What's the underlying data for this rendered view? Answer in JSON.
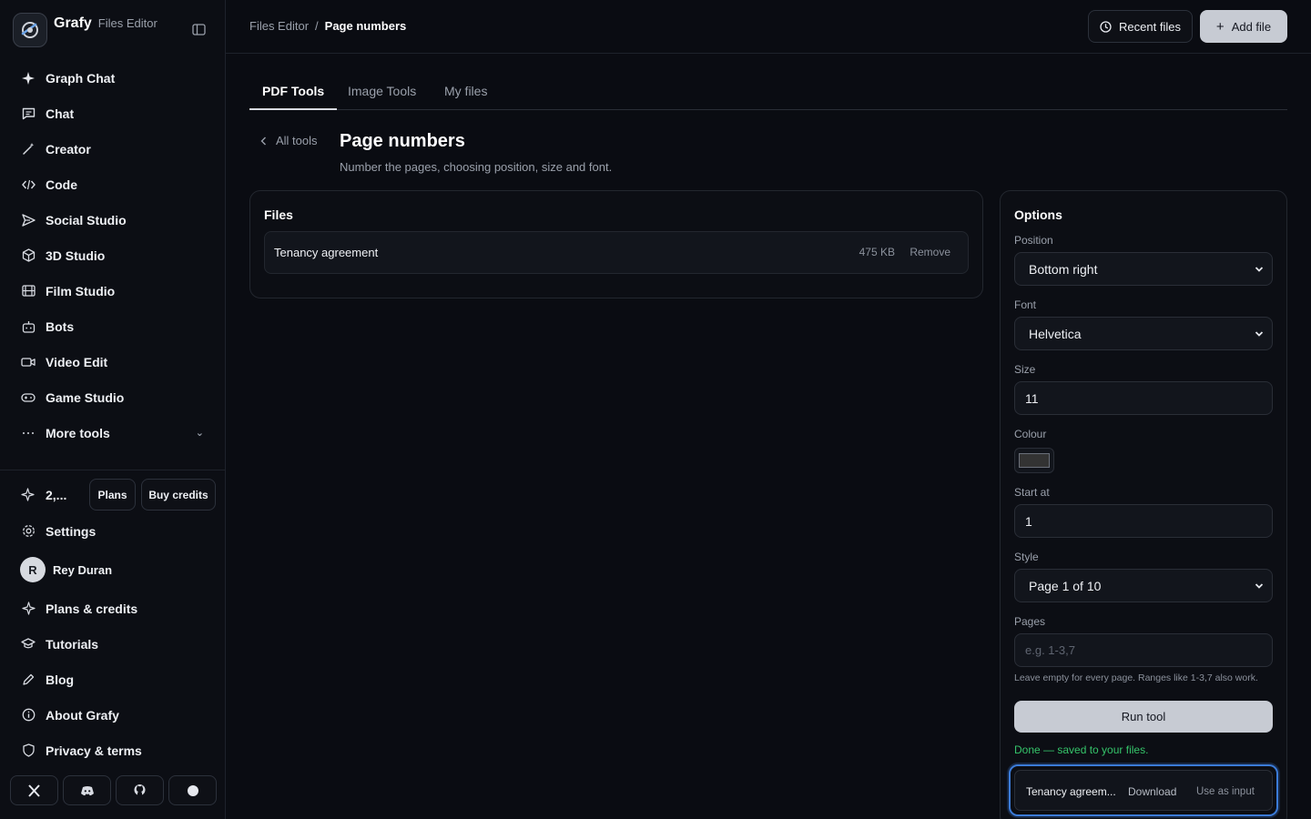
{
  "brand": {
    "name": "Grafy",
    "subtitle": "Files Editor"
  },
  "sidebar": {
    "items": [
      {
        "label": "Graph Chat",
        "icon": "sparkle-icon"
      },
      {
        "label": "Chat",
        "icon": "chat-bubble-icon"
      },
      {
        "label": "Creator",
        "icon": "magic-wand-icon"
      },
      {
        "label": "Code",
        "icon": "code-icon"
      },
      {
        "label": "Social Studio",
        "icon": "send-icon"
      },
      {
        "label": "3D Studio",
        "icon": "cube-icon"
      },
      {
        "label": "Film Studio",
        "icon": "film-icon"
      },
      {
        "label": "Bots",
        "icon": "bot-icon"
      },
      {
        "label": "Video Edit",
        "icon": "video-camera-icon"
      },
      {
        "label": "Game Studio",
        "icon": "gamepad-icon"
      },
      {
        "label": "More tools",
        "icon": "ellipsis-icon"
      }
    ],
    "credits": {
      "value": "2,...",
      "plans_label": "Plans",
      "buy_label": "Buy credits"
    },
    "settings_label": "Settings",
    "user": {
      "initial": "R",
      "name": "Rey Duran"
    },
    "lower_items": [
      {
        "label": "Plans & credits",
        "icon": "sparkle-icon"
      },
      {
        "label": "Tutorials",
        "icon": "graduation-cap-icon"
      },
      {
        "label": "Blog",
        "icon": "pen-icon"
      },
      {
        "label": "About Grafy",
        "icon": "info-icon"
      },
      {
        "label": "Privacy & terms",
        "icon": "shield-icon"
      }
    ],
    "social": [
      "x-icon",
      "discord-icon",
      "github-icon",
      "circle-icon"
    ]
  },
  "topbar": {
    "breadcrumb": {
      "parent": "Files Editor",
      "separator": "/",
      "current": "Page numbers"
    },
    "recent_files_label": "Recent files",
    "add_file_label": "Add file"
  },
  "tabs": [
    {
      "label": "PDF Tools",
      "active": true
    },
    {
      "label": "Image Tools",
      "active": false
    },
    {
      "label": "My files",
      "active": false
    }
  ],
  "tool": {
    "back_label": "All tools",
    "title": "Page numbers",
    "description": "Number the pages, choosing position, size and font."
  },
  "files": {
    "title": "Files",
    "items": [
      {
        "name": "Tenancy agreement",
        "size": "475 KB",
        "remove_label": "Remove"
      }
    ]
  },
  "options": {
    "title": "Options",
    "position": {
      "label": "Position",
      "value": "Bottom right"
    },
    "font": {
      "label": "Font",
      "value": "Helvetica"
    },
    "size": {
      "label": "Size",
      "value": "11"
    },
    "colour": {
      "label": "Colour",
      "value": "#333333"
    },
    "start_at": {
      "label": "Start at",
      "value": "1"
    },
    "style": {
      "label": "Style",
      "value": "Page 1 of 10"
    },
    "pages": {
      "label": "Pages",
      "value": "",
      "placeholder": "e.g. 1-3,7"
    },
    "hint": "Leave empty for every page. Ranges like 1-3,7 also work.",
    "run_label": "Run tool",
    "status": "Done — saved to your files."
  },
  "result": {
    "name": "Tenancy agreem...",
    "download_label": "Download",
    "use_label": "Use as input"
  },
  "colors": {
    "accent_status": "#35c46a",
    "focus_ring": "#3b7bd8",
    "primary_button": "#c7cbd3"
  }
}
